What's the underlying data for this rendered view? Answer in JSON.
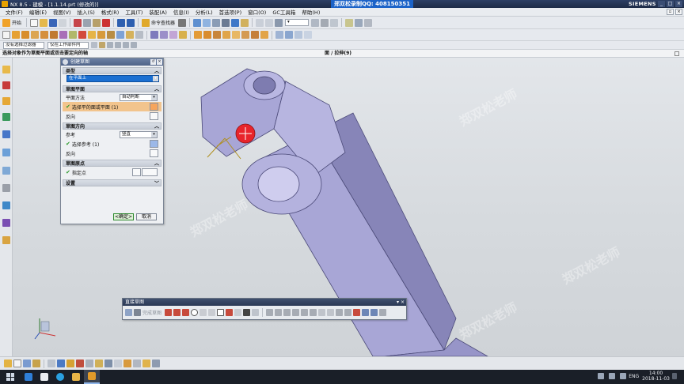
{
  "window": {
    "title": "NX 8.5 - 建模 - [1.1.14.prt  (修改的)]",
    "watermark": "郑双松录制QQ: 408150351",
    "brand": "SIEMENS",
    "controls": [
      "_",
      "□",
      "×"
    ]
  },
  "menubar": {
    "items": [
      "文件(F)",
      "编辑(E)",
      "视图(V)",
      "插入(S)",
      "格式(R)",
      "工具(T)",
      "装配(A)",
      "信息(I)",
      "分析(L)",
      "首选项(P)",
      "窗口(O)",
      "GC工具箱",
      "帮助(H)"
    ]
  },
  "toolbar1": {
    "start_label": "开始",
    "command_finder": "命令查找器",
    "view_select": "▾"
  },
  "toolbar3": {
    "filter": "没有选择过滤器",
    "scope": "仅在工作部件内"
  },
  "cueline": {
    "cue": "选择对象作为草图平面或双击要定向的轴",
    "status": "面 / 拉伸(9)"
  },
  "dialog": {
    "title": "创建草图",
    "type_header": "类型",
    "type_value": "在平面上",
    "plane_header": "草图平面",
    "plane_method_label": "平面方法",
    "plane_method_value": "自动判断",
    "select_plane_label": "选择平的面或平面 (1)",
    "reverse_label_1": "反向",
    "orientation_header": "草图方向",
    "reference_label": "参考",
    "reference_value": "竖直",
    "select_ref_label": "选择参考 (1)",
    "reverse_label_2": "反向",
    "origin_header": "草图原点",
    "specify_point_label": "指定点",
    "settings_header": "设置",
    "ok_label": "<确定>",
    "cancel_label": "取消"
  },
  "sketchbar": {
    "title": "直接草图",
    "finish_label": "完成草图"
  },
  "taskbar": {
    "lang": "ENG",
    "time": "14:00",
    "date": "2018-11-03"
  },
  "graphics": {
    "part_color": "#a8a6d6",
    "part_shadow": "#8785b8",
    "marker_color": "#e8242b",
    "watermark_text": "郑双松老师"
  }
}
